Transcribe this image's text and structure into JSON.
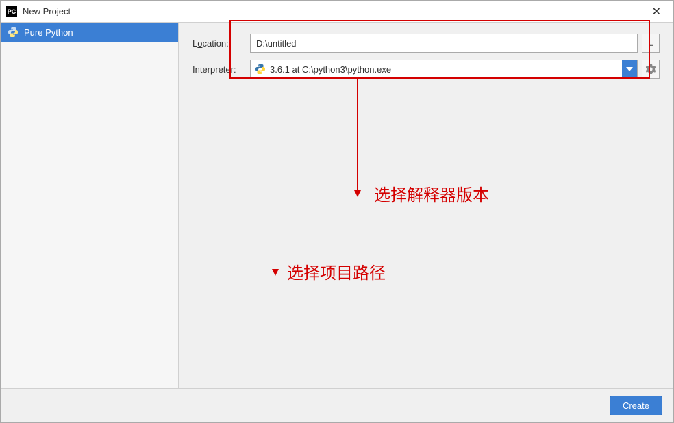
{
  "titlebar": {
    "title": "New Project",
    "app_icon_label": "PC"
  },
  "sidebar": {
    "items": [
      {
        "label": "Pure Python"
      }
    ]
  },
  "form": {
    "location_label_pre": "L",
    "location_label_u": "o",
    "location_label_post": "cation:",
    "location_value": "D:\\untitled",
    "browse_label": "...",
    "interpreter_label": "Interpreter:",
    "interpreter_value": "3.6.1 at C:\\python3\\python.exe"
  },
  "footer": {
    "create_label": "Create"
  },
  "annotations": {
    "interpreter_note": "选择解释器版本",
    "path_note": "选择项目路径"
  }
}
